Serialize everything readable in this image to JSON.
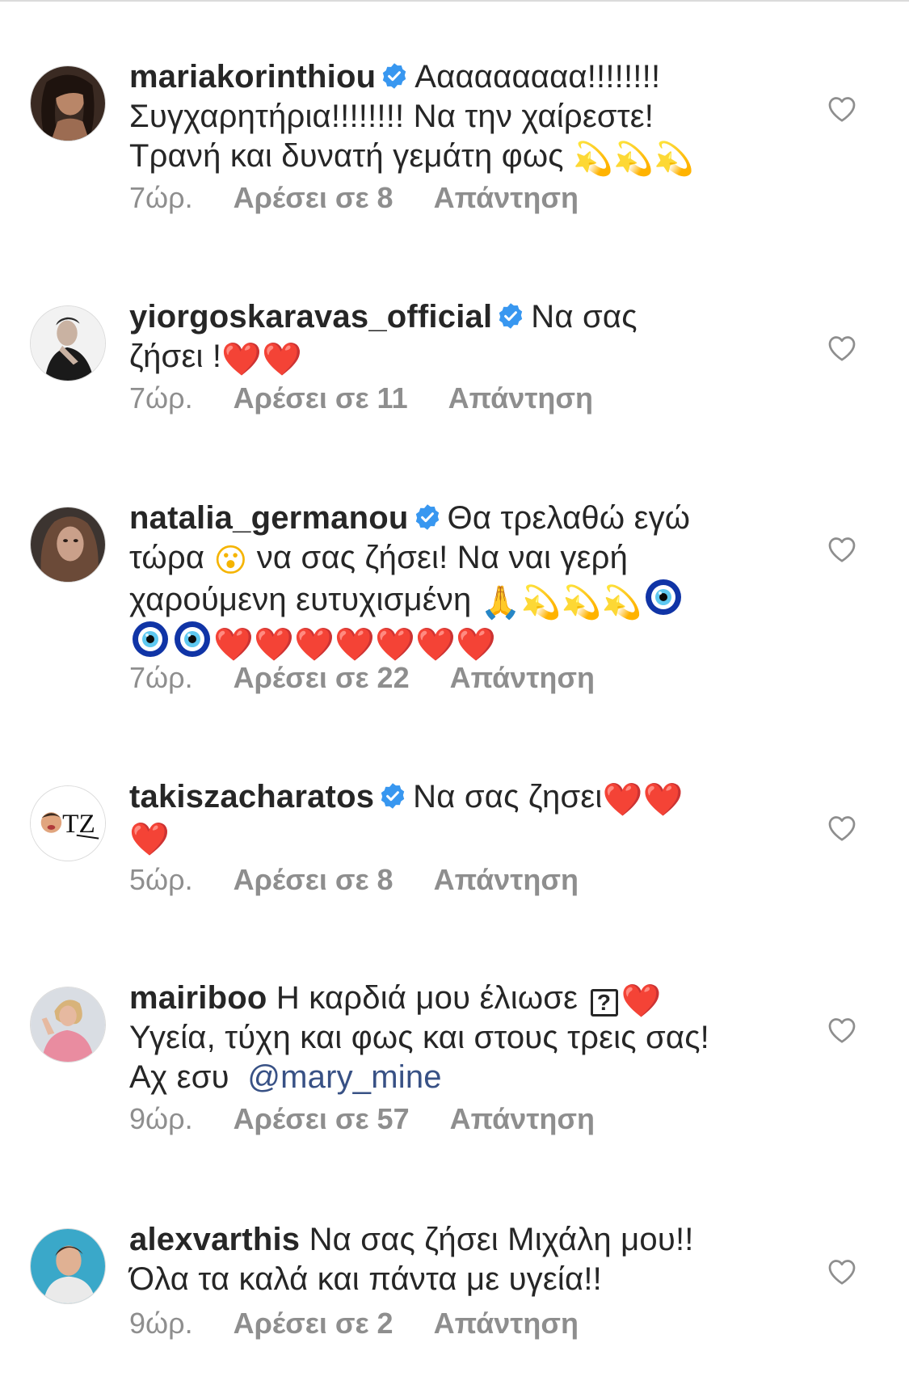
{
  "comments": [
    {
      "username": "mariakorinthiou",
      "verified": true,
      "lines": [
        "Ααααααααα!!!!!!!!",
        "Συγχαρητήρια!!!!!!!! Να την χαίρεστε!",
        "Τρανή και δυνατή γεμάτη φως"
      ],
      "time": "7ώρ.",
      "likes": "Αρέσει σε 8",
      "reply": "Απάντηση"
    },
    {
      "username": "yiorgoskaravas_official",
      "verified": true,
      "lines": [
        "Να σας",
        "ζήσει !"
      ],
      "time": "7ώρ.",
      "likes": "Αρέσει σε 11",
      "reply": "Απάντηση"
    },
    {
      "username": "natalia_germanou",
      "verified": true,
      "lines": [
        "Θα τρελαθώ εγώ",
        "τώρα",
        "να σας ζήσει! Να ναι γερή",
        "χαρούμενη ευτυχισμένη"
      ],
      "time": "7ώρ.",
      "likes": "Αρέσει σε 22",
      "reply": "Απάντηση"
    },
    {
      "username": "takiszacharatos",
      "verified": true,
      "lines": [
        "Να σας ζησει"
      ],
      "avatar_text": "TZ",
      "time": "5ώρ.",
      "likes": "Αρέσει σε 8",
      "reply": "Απάντηση"
    },
    {
      "username": "mairiboo",
      "verified": false,
      "lines": [
        "Η καρδιά μου έλιωσε",
        "Υγεία, τύχη και φως και στους τρεις σας!",
        "Αχ εσυ"
      ],
      "unknown_glyph": "?",
      "mention": "@mary_mine",
      "time": "9ώρ.",
      "likes": "Αρέσει σε 57",
      "reply": "Απάντηση"
    },
    {
      "username": "alexvarthis",
      "verified": false,
      "lines": [
        "Να σας ζήσει Μιχάλη μου!!",
        "Όλα τα καλά και πάντα με υγεία!!"
      ],
      "time": "9ώρ.",
      "likes": "Αρέσει σε 2",
      "reply": "Απάντηση"
    }
  ],
  "icons": {
    "verified": "verified-badge-icon",
    "like": "heart-outline-icon",
    "heart_emoji": "red-heart-emoji",
    "star_emoji": "dizzy-star-emoji",
    "eye_emoji": "nazar-amulet-emoji",
    "hands_emoji": "folded-hands-emoji",
    "face_emoji": "astonished-face-emoji"
  },
  "colors": {
    "text": "#262626",
    "meta": "#8e8e8e",
    "verified": "#3897f0",
    "mention": "#385185",
    "heart": "#e0102a"
  }
}
